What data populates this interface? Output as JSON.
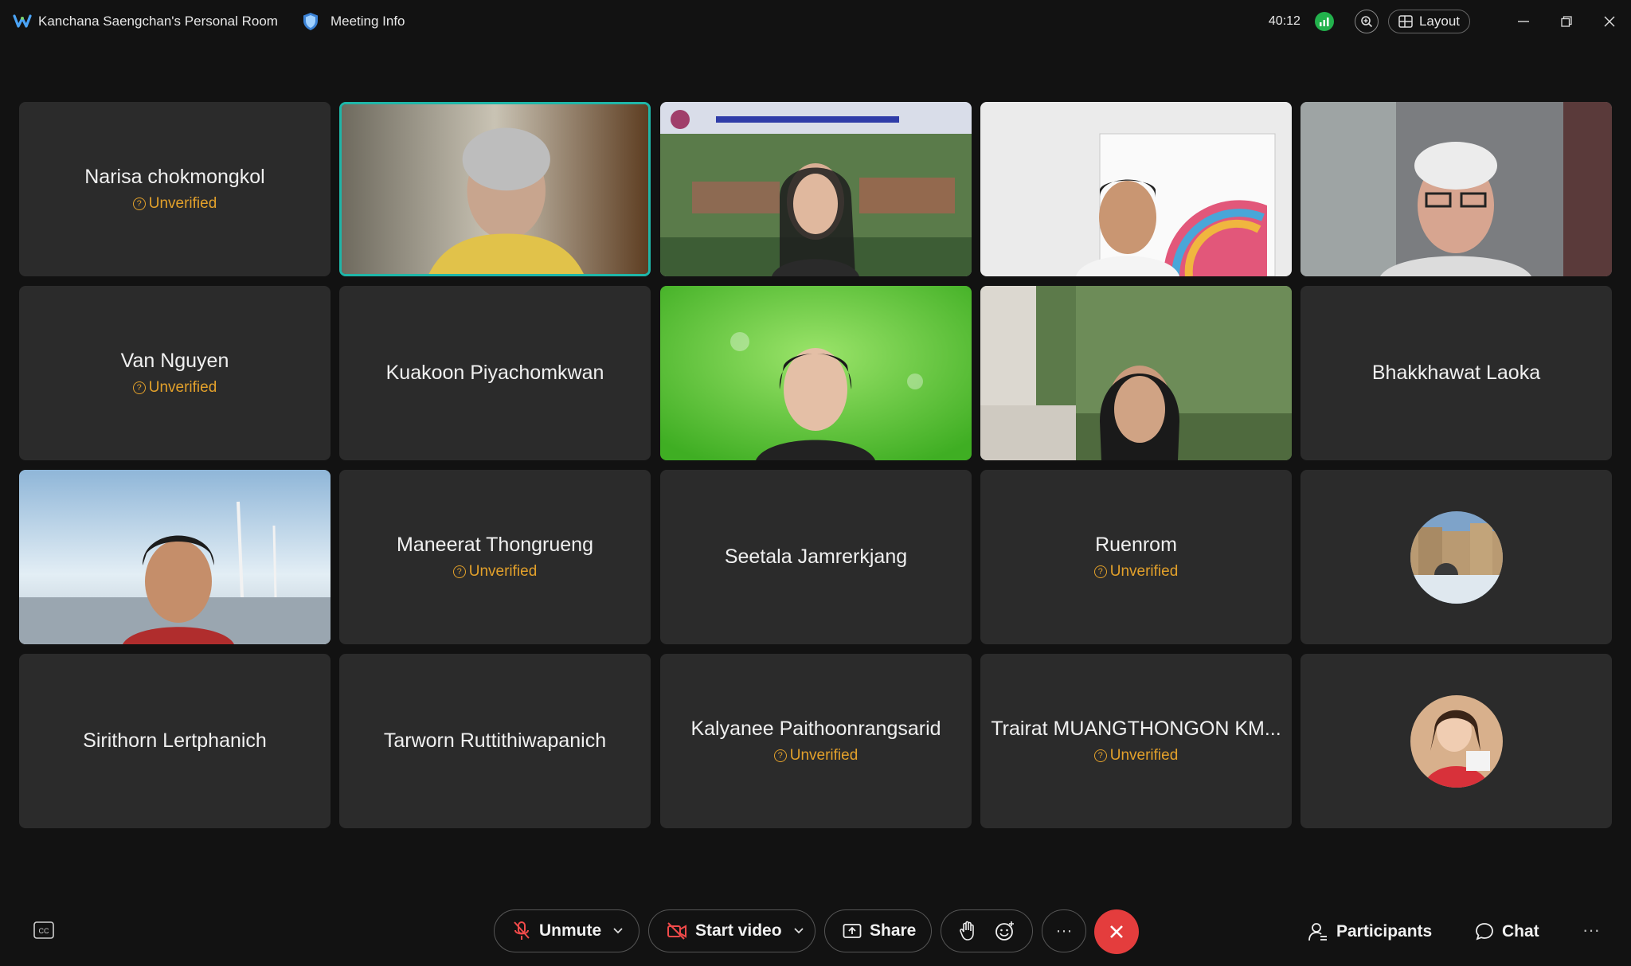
{
  "topbar": {
    "room_title": "Kanchana Saengchan's Personal Room",
    "meeting_info": "Meeting Info",
    "timer": "40:12",
    "layout_label": "Layout"
  },
  "tiles": [
    {
      "name": "Narisa chokmongkol",
      "badge": "Unverified"
    },
    {
      "name": "Van Nguyen",
      "badge": "Unverified"
    },
    {
      "name": "Kuakoon Piyachomkwan"
    },
    {
      "name": "Bhakkhawat Laoka"
    },
    {
      "name": "Maneerat Thongrueng",
      "badge": "Unverified"
    },
    {
      "name": "Seetala Jamrerkjang"
    },
    {
      "name": "Ruenrom",
      "badge": "Unverified"
    },
    {
      "name": "Sirithorn Lertphanich"
    },
    {
      "name": "Tarworn Ruttithiwapanich"
    },
    {
      "name": "Kalyanee Paithoonrangsarid",
      "badge": "Unverified"
    },
    {
      "name": "Trairat MUANGTHONGON KM...",
      "badge": "Unverified"
    }
  ],
  "controls": {
    "unmute": "Unmute",
    "start_video": "Start video",
    "share": "Share",
    "more": "···",
    "participants": "Participants",
    "chat": "Chat"
  },
  "colors": {
    "background": "#121212",
    "tile": "#2b2b2b",
    "active_speaker": "#1fb6a8",
    "unverified": "#e3a12b",
    "end_call": "#e43d3d",
    "signal": "#22b14c"
  }
}
